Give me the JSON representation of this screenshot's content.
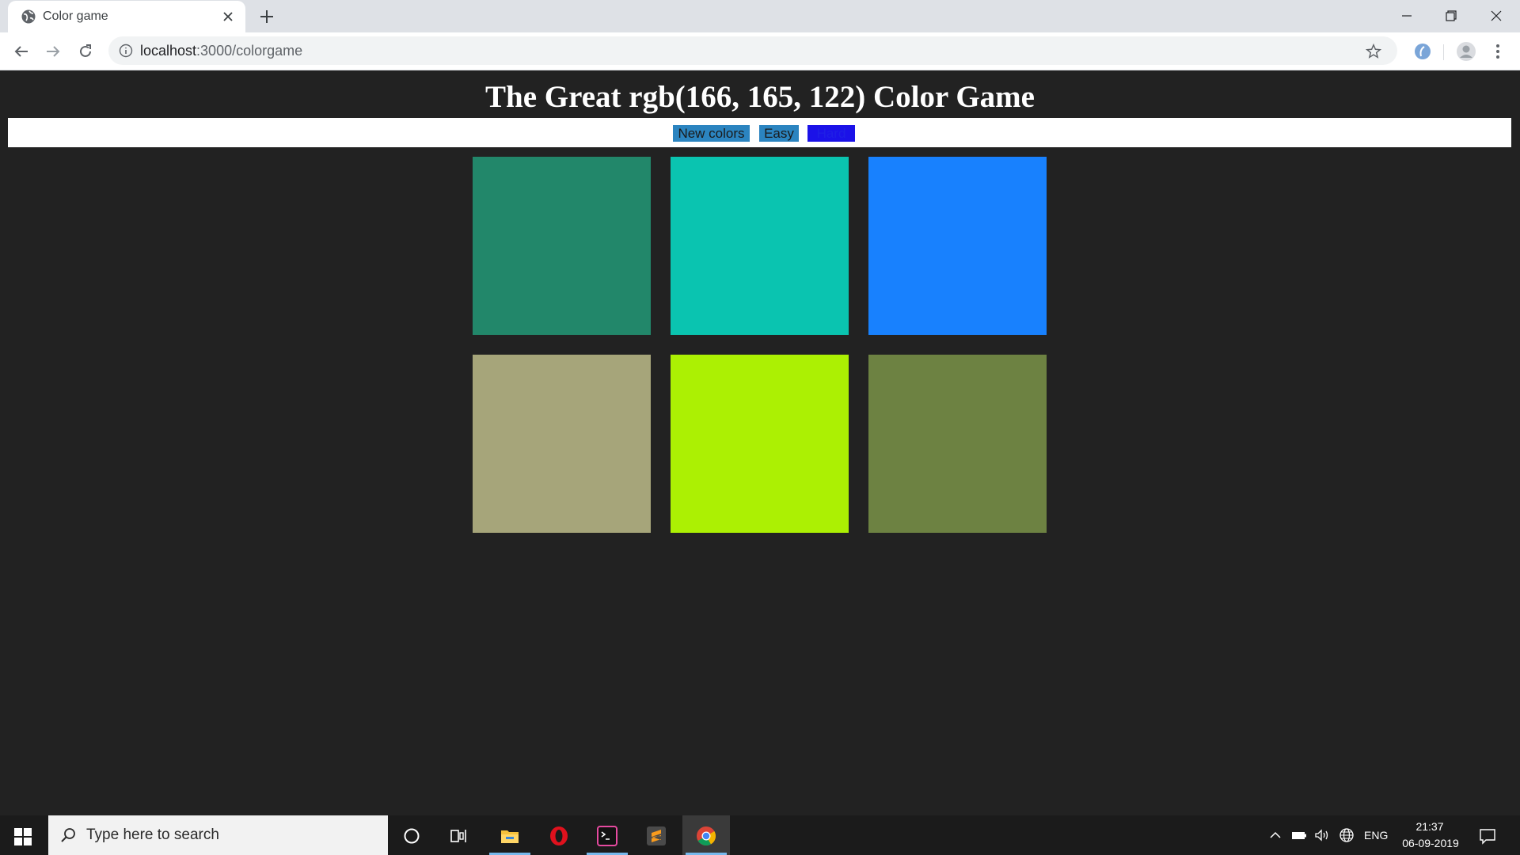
{
  "browser": {
    "tab_title": "Color game",
    "url_host": "localhost",
    "url_path": ":3000/colorgame"
  },
  "game": {
    "title": "The Great rgb(166, 165, 122) Color Game",
    "buttons": {
      "new_colors": "New colors",
      "easy": "Easy",
      "hard": "Hard"
    },
    "squares": [
      {
        "color": "#22876a"
      },
      {
        "color": "#0ac4b0"
      },
      {
        "color": "#1881fe"
      },
      {
        "color": "#a6a57a"
      },
      {
        "color": "#acf003"
      },
      {
        "color": "#6d8242"
      }
    ]
  },
  "taskbar": {
    "search_placeholder": "Type here to search",
    "language": "ENG",
    "time": "21:37",
    "date": "06-09-2019"
  }
}
